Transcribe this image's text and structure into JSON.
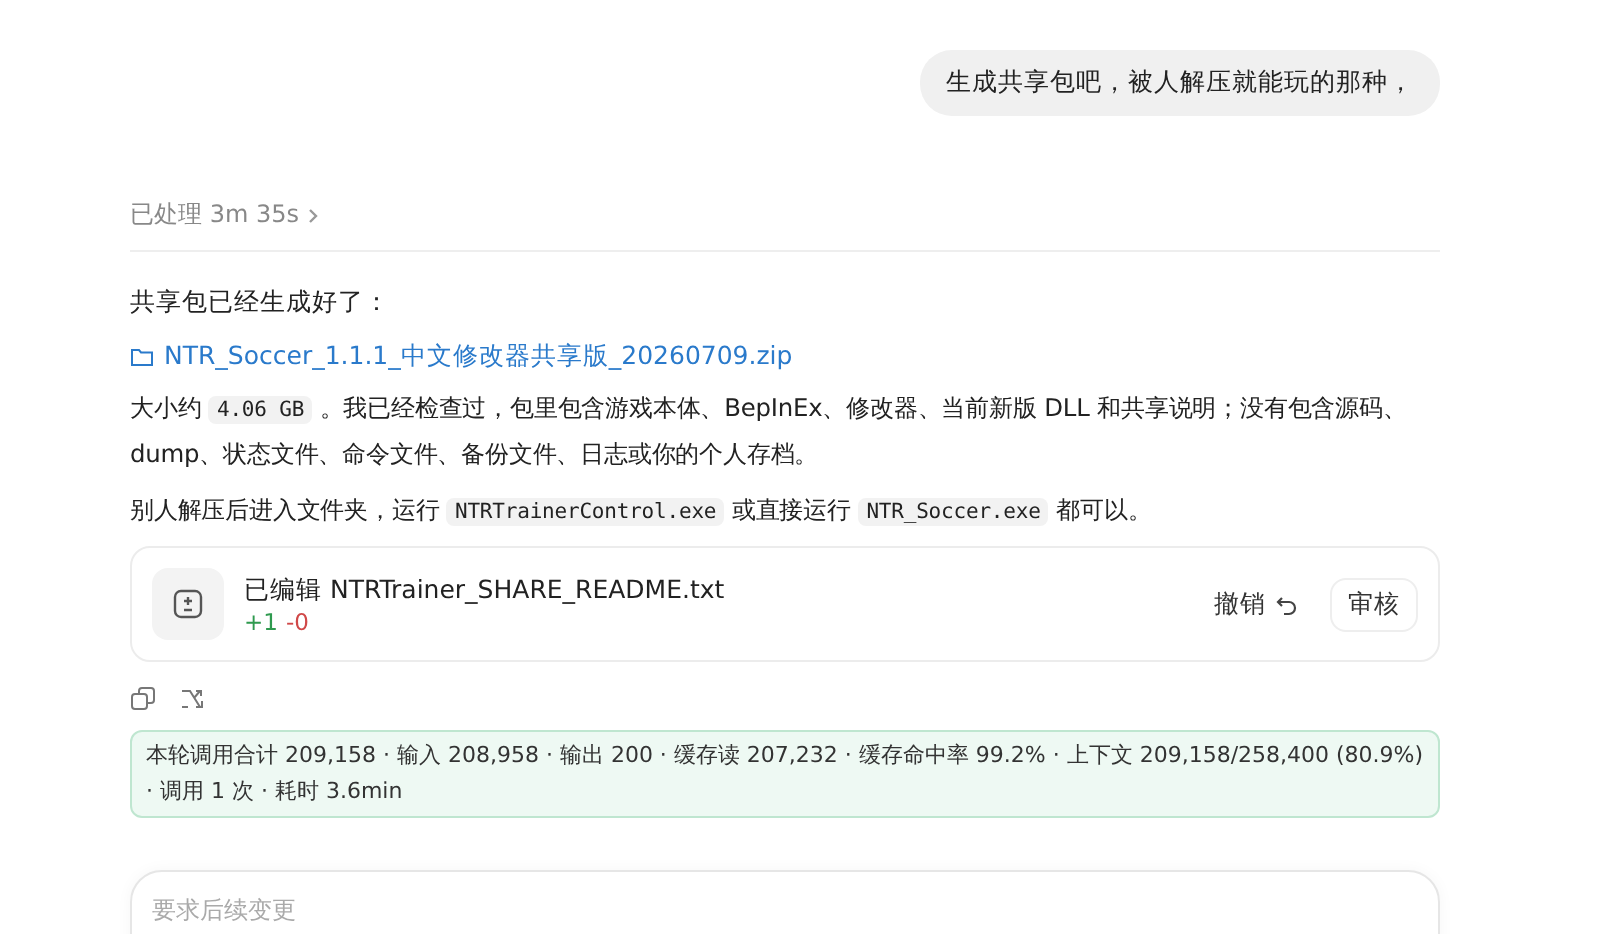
{
  "user_message": "生成共享包吧，被人解压就能玩的那种，",
  "processed": {
    "label": "已处理 3m 35s",
    "expanded": false
  },
  "reply": {
    "intro": "共享包已经生成好了：",
    "file_link": "NTR_Soccer_1.1.1_中文修改器共享版_20260709.zip",
    "paragraphs": [
      [
        {
          "kind": "text",
          "text": "大小约 "
        },
        {
          "kind": "code",
          "text": "4.06 GB"
        },
        {
          "kind": "text",
          "text": " 。我已经检查过，包里包含游戏本体、BepInEx、修改器、当前新版 DLL 和共享说明；没有包含源码、dump、状态文件、命令文件、备份文件、日志或你的个人存档。"
        }
      ],
      [
        {
          "kind": "text",
          "text": "别人解压后进入文件夹，运行 "
        },
        {
          "kind": "code",
          "text": "NTRTrainerControl.exe"
        },
        {
          "kind": "text",
          "text": " 或直接运行 "
        },
        {
          "kind": "code",
          "text": "NTR_Soccer.exe"
        },
        {
          "kind": "text",
          "text": " 都可以。"
        }
      ]
    ]
  },
  "edit_card": {
    "title": "已编辑 NTRTrainer_SHARE_README.txt",
    "added": "+1",
    "removed": "-0",
    "undo": "撤销",
    "review": "审核"
  },
  "usage": "本轮调用合计 209,158 · 输入 208,958 · 输出 200 · 缓存读 207,232 · 缓存命中率 99.2% · 上下文 209,158/258,400 (80.9%) · 调用 1 次 · 耗时 3.6min",
  "composer": {
    "placeholder": "要求后续变更"
  }
}
